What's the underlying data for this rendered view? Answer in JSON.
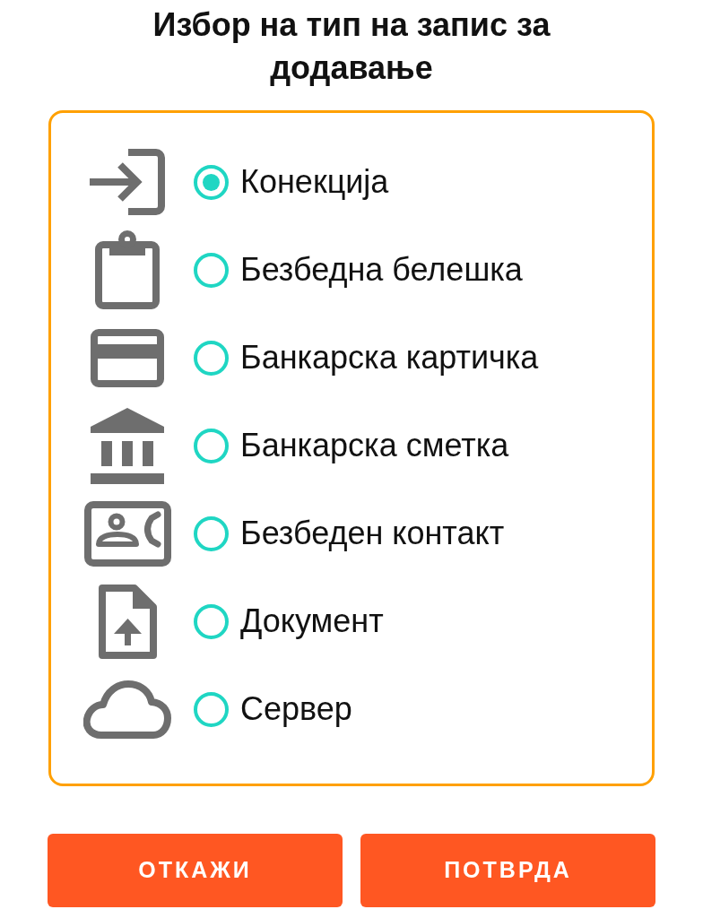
{
  "title": "Избор на тип на запис за додавање",
  "options": [
    {
      "kind": "login",
      "label": "Конекција",
      "selected": true
    },
    {
      "kind": "note",
      "label": "Безбедна белешка",
      "selected": false
    },
    {
      "kind": "card",
      "label": "Банкарска картичка",
      "selected": false
    },
    {
      "kind": "bank",
      "label": "Банкарска сметка",
      "selected": false
    },
    {
      "kind": "contact",
      "label": "Безбеден контакт",
      "selected": false
    },
    {
      "kind": "document",
      "label": "Документ",
      "selected": false
    },
    {
      "kind": "server",
      "label": "Сервер",
      "selected": false
    }
  ],
  "buttons": [
    {
      "label": "ОТКАЖИ"
    },
    {
      "label": "ПОТВРДА"
    }
  ]
}
